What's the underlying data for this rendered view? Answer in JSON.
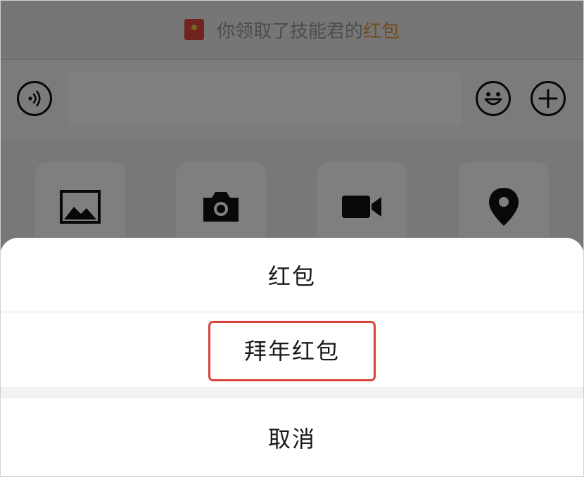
{
  "notice": {
    "prefix": "你领取了技能君的",
    "highlight": "红包",
    "icon": "red-packet-icon"
  },
  "input_bar": {
    "placeholder": "",
    "voice_icon": "voice-icon",
    "emoji_icon": "emoji-icon",
    "plus_icon": "plus-icon"
  },
  "panel": {
    "tiles": [
      {
        "icon": "image-icon"
      },
      {
        "icon": "camera-icon"
      },
      {
        "icon": "video-icon"
      },
      {
        "icon": "location-icon"
      }
    ]
  },
  "action_sheet": {
    "items": [
      {
        "label": "红包"
      },
      {
        "label": "拜年红包",
        "highlighted": true
      }
    ],
    "cancel_label": "取消"
  },
  "colors": {
    "highlight_text": "#e9963e",
    "annotation_border": "#d9443a",
    "red_packet": "#e5473a"
  }
}
